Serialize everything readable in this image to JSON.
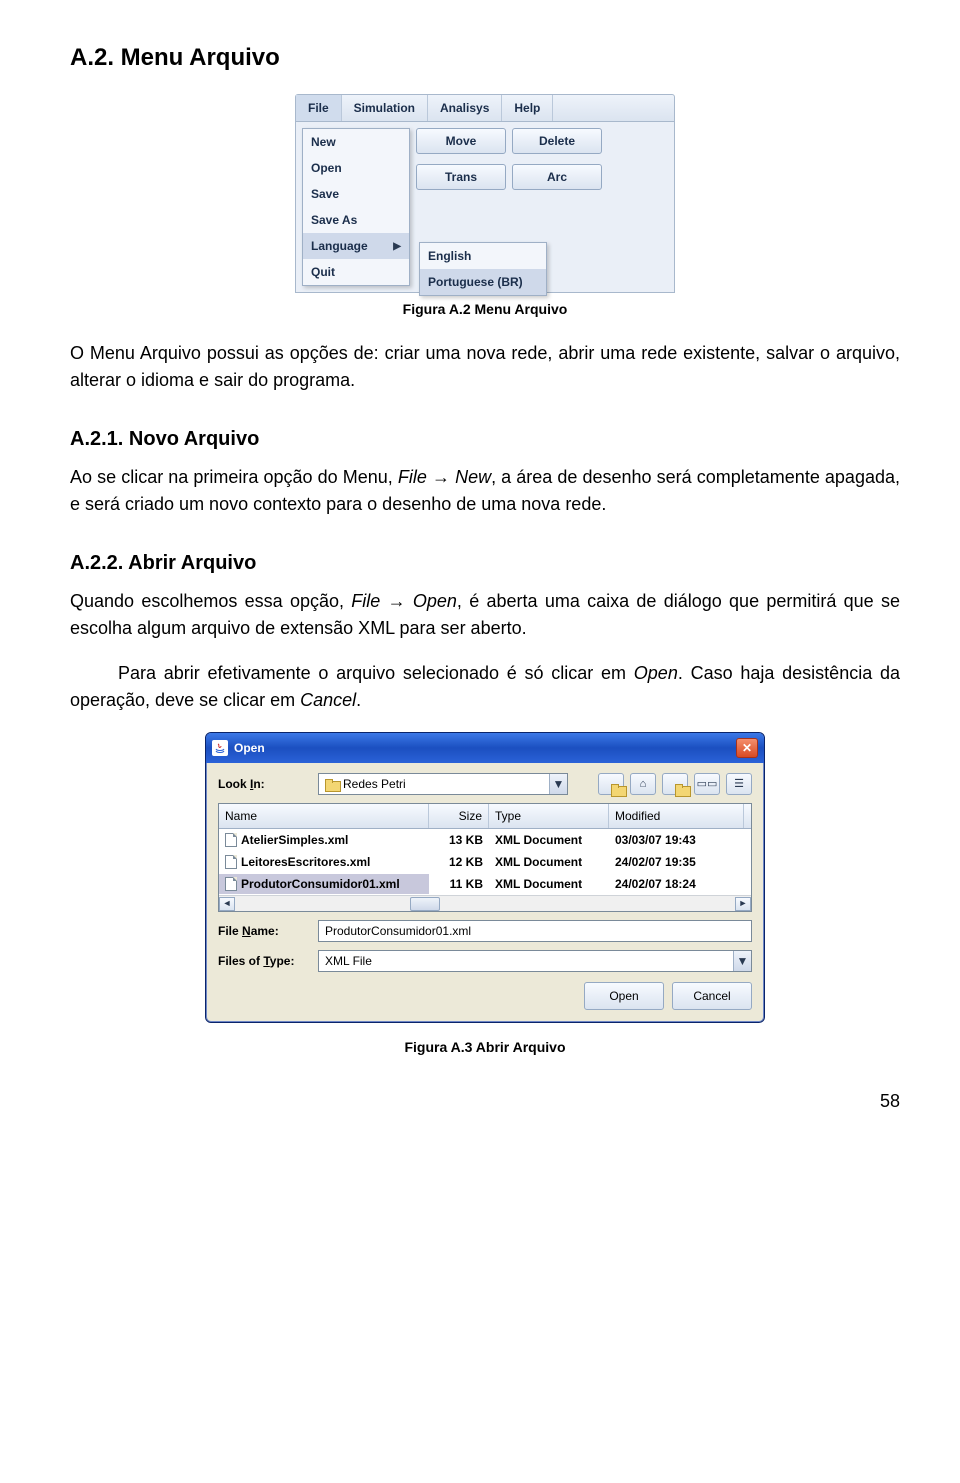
{
  "headings": {
    "h2": "A.2.  Menu Arquivo",
    "h3_1": "A.2.1.  Novo Arquivo",
    "h3_2": "A.2.2.  Abrir Arquivo"
  },
  "paragraphs": {
    "p1a": "O Menu Arquivo possui as opções de: criar uma nova rede, abrir uma rede existente, salvar o arquivo, alterar o idioma e sair do programa.",
    "p2a": "Ao se clicar na primeira opção do Menu, ",
    "p2b": "File",
    "p2c": " → ",
    "p2d": "New",
    "p2e": ", a área de desenho será completamente apagada, e será criado um novo contexto para o desenho de uma nova rede.",
    "p3a": "Quando escolhemos essa opção, ",
    "p3b": "File",
    "p3c": " → ",
    "p3d": "Open",
    "p3e": ", é aberta uma caixa de diálogo que permitirá que se escolha algum arquivo de extensão XML para ser aberto.",
    "p4a": "Para abrir efetivamente o arquivo selecionado é só clicar em ",
    "p4b": "Open",
    "p4c": ". Caso haja desistência da operação, deve se clicar em ",
    "p4d": "Cancel",
    "p4e": "."
  },
  "captions": {
    "figA2": "Figura A.2 Menu Arquivo",
    "figA3": "Figura A.3 Abrir Arquivo"
  },
  "page_number": "58",
  "menu": {
    "menubar": [
      "File",
      "Simulation",
      "Analisys",
      "Help"
    ],
    "file_items": [
      "New",
      "Open",
      "Save",
      "Save As",
      "Language",
      "Quit"
    ],
    "lang_items": [
      "English",
      "Portuguese (BR)"
    ],
    "buttons_col1": [
      "Move",
      "Trans"
    ],
    "buttons_col2": [
      "Delete",
      "Arc"
    ]
  },
  "open_dialog": {
    "title": "Open",
    "look_in_label": "Look In:",
    "look_in_value": "Redes Petri",
    "columns": {
      "name": "Name",
      "size": "Size",
      "type": "Type",
      "modified": "Modified"
    },
    "rows": [
      {
        "name": "AtelierSimples.xml",
        "size": "13 KB",
        "type": "XML Document",
        "modified": "03/03/07 19:43"
      },
      {
        "name": "LeitoresEscritores.xml",
        "size": "12 KB",
        "type": "XML Document",
        "modified": "24/02/07 19:35"
      },
      {
        "name": "ProdutorConsumidor01.xml",
        "size": "11 KB",
        "type": "XML Document",
        "modified": "24/02/07 18:24"
      }
    ],
    "file_name_label": "File Name:",
    "file_name_value": "ProdutorConsumidor01.xml",
    "files_of_type_label": "Files of Type:",
    "files_of_type_value": "XML File",
    "open_btn": "Open",
    "cancel_btn": "Cancel"
  }
}
